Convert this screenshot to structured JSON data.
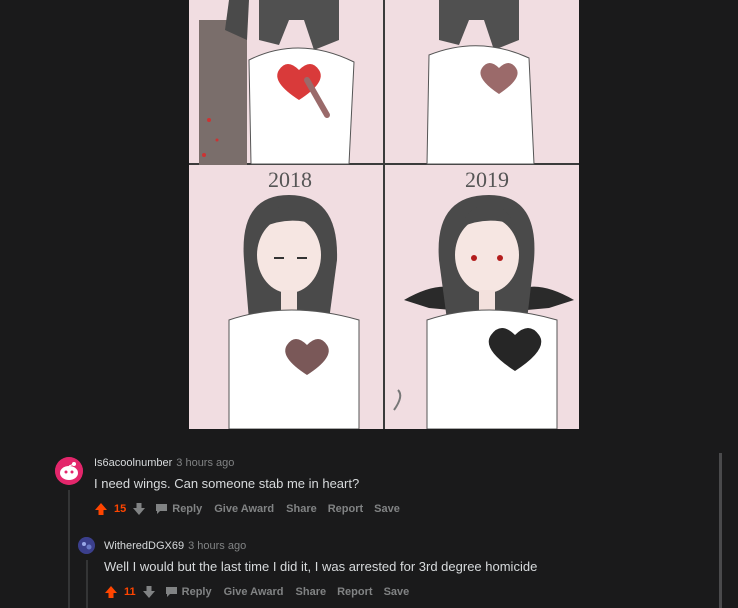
{
  "comic": {
    "year_left": "2018",
    "year_right": "2019"
  },
  "comments": [
    {
      "username": "Is6acoolnumber",
      "time": "3 hours ago",
      "text": "I need wings. Can someone stab me in heart?",
      "score": "15",
      "actions": {
        "reply": "Reply",
        "award": "Give Award",
        "share": "Share",
        "report": "Report",
        "save": "Save"
      }
    },
    {
      "username": "WitheredDGX69",
      "time": "3 hours ago",
      "text": "Well I would but the last time I did it, I was arrested for 3rd degree homicide",
      "score": "11",
      "actions": {
        "reply": "Reply",
        "award": "Give Award",
        "share": "Share",
        "report": "Report",
        "save": "Save"
      }
    }
  ],
  "colors": {
    "upvote": "#ff4500",
    "background": "#1a1a1b",
    "muted": "#818384",
    "text": "#d7dadc"
  }
}
